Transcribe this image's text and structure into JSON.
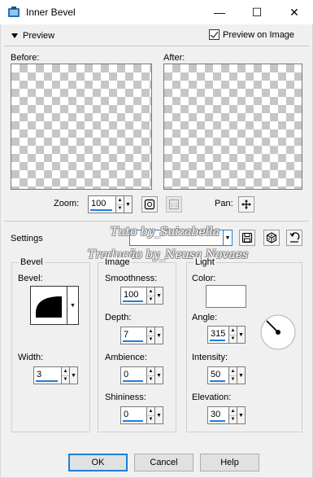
{
  "window": {
    "title": "Inner Bevel",
    "minimize": "—",
    "maximize": "☐",
    "close": "✕"
  },
  "preview": {
    "toggle_label": "Preview",
    "preview_on_image_label": "Preview on Image",
    "preview_on_image_checked": true,
    "before_label": "Before:",
    "after_label": "After:",
    "zoom_label": "Zoom:",
    "zoom_value": "100",
    "pan_label": "Pan:"
  },
  "settings": {
    "label": "Settings",
    "preset_value": ""
  },
  "watermark": {
    "line1": "Tuto by_Suizabella",
    "line2": "Tradução by_Neusa Novaes"
  },
  "bevel_group": {
    "title": "Bevel",
    "bevel_label": "Bevel:",
    "width_label": "Width:",
    "width_value": "3"
  },
  "image_group": {
    "title": "Image",
    "smoothness_label": "Smoothness:",
    "smoothness_value": "100",
    "depth_label": "Depth:",
    "depth_value": "7",
    "ambience_label": "Ambience:",
    "ambience_value": "0",
    "shininess_label": "Shininess:",
    "shininess_value": "0"
  },
  "light_group": {
    "title": "Light",
    "color_label": "Color:",
    "color_value": "#ffffff",
    "angle_label": "Angle:",
    "angle_value": "315",
    "intensity_label": "Intensity:",
    "intensity_value": "50",
    "elevation_label": "Elevation:",
    "elevation_value": "30"
  },
  "buttons": {
    "ok": "OK",
    "cancel": "Cancel",
    "help": "Help"
  },
  "colors": {
    "accent": "#1e7fd8"
  }
}
